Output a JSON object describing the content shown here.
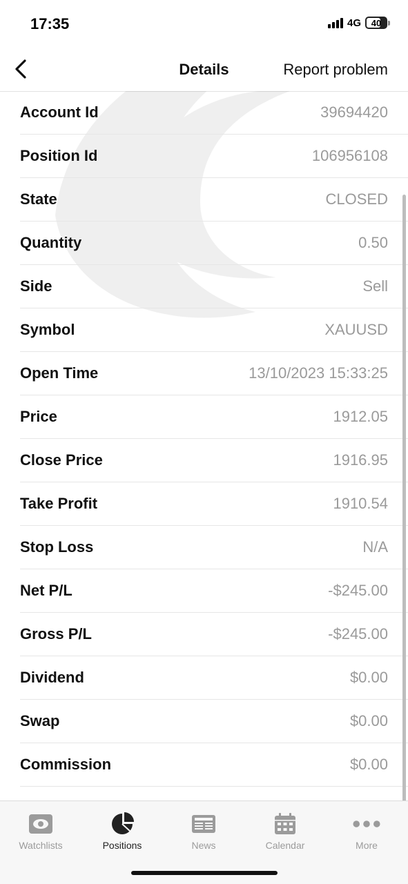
{
  "status": {
    "time": "17:35",
    "network": "4G",
    "battery": "40"
  },
  "navbar": {
    "title": "Details",
    "action": "Report problem"
  },
  "rows": [
    {
      "label": "Account Id",
      "value": "39694420"
    },
    {
      "label": "Position Id",
      "value": "106956108"
    },
    {
      "label": "State",
      "value": "CLOSED"
    },
    {
      "label": "Quantity",
      "value": "0.50"
    },
    {
      "label": "Side",
      "value": "Sell"
    },
    {
      "label": "Symbol",
      "value": "XAUUSD"
    },
    {
      "label": "Open Time",
      "value": "13/10/2023 15:33:25"
    },
    {
      "label": "Price",
      "value": "1912.05"
    },
    {
      "label": "Close Price",
      "value": "1916.95"
    },
    {
      "label": "Take Profit",
      "value": "1910.54"
    },
    {
      "label": "Stop Loss",
      "value": "N/A"
    },
    {
      "label": "Net P/L",
      "value": "-$245.00"
    },
    {
      "label": "Gross P/L",
      "value": "-$245.00"
    },
    {
      "label": "Dividend",
      "value": "$0.00"
    },
    {
      "label": "Swap",
      "value": "$0.00"
    },
    {
      "label": "Commission",
      "value": "$0.00"
    }
  ],
  "tabs": [
    {
      "label": "Watchlists",
      "icon": "eye-icon"
    },
    {
      "label": "Positions",
      "icon": "pie-chart-icon",
      "active": true
    },
    {
      "label": "News",
      "icon": "newspaper-icon"
    },
    {
      "label": "Calendar",
      "icon": "calendar-icon"
    },
    {
      "label": "More",
      "icon": "more-dots-icon"
    }
  ],
  "colors": {
    "value_gray": "#9a9a9a",
    "tab_inactive": "#9b9b9b",
    "text": "#111111"
  }
}
